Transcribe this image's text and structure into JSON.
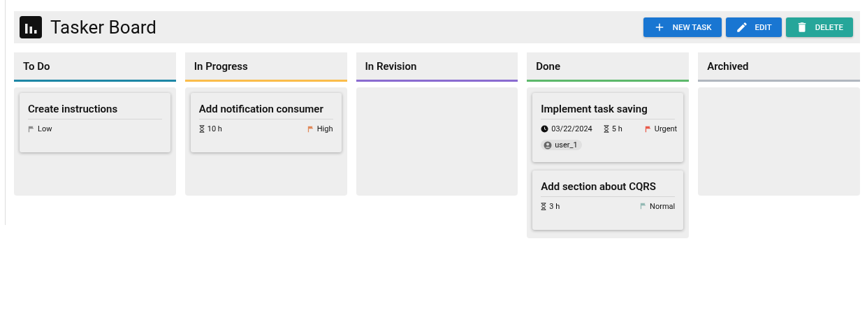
{
  "app": {
    "title": "Tasker Board"
  },
  "buttons": [
    {
      "label": "NEW TASK",
      "kind": "add"
    },
    {
      "label": "EDIT",
      "kind": "edit"
    },
    {
      "label": "DELETE",
      "kind": "delete"
    }
  ],
  "columns": [
    {
      "title": "To Do",
      "color": "#1e87a6",
      "tasks": [
        {
          "title": "Create instructions",
          "priority": {
            "label": "Low",
            "color": "#8c8c8c"
          }
        }
      ]
    },
    {
      "title": "In Progress",
      "color": "#fbbd4b",
      "tasks": [
        {
          "title": "Add notification consumer",
          "estimate": "10 h",
          "priority": {
            "label": "High",
            "color": "#e0895a"
          }
        }
      ]
    },
    {
      "title": "In Revision",
      "color": "#8a6bd0"
    },
    {
      "title": "Done",
      "color": "#5db96b",
      "tasks": [
        {
          "title": "Implement task saving",
          "due": "03/22/2024",
          "estimate": "5 h",
          "priority": {
            "label": "Urgent",
            "color": "#e85a4a"
          },
          "assignee": "user_1"
        },
        {
          "title": "Add section about CQRS",
          "estimate": "3 h",
          "priority": {
            "label": "Normal",
            "color": "#93b9b4"
          }
        }
      ]
    },
    {
      "title": "Archived",
      "color": "#b1b7bf"
    }
  ]
}
